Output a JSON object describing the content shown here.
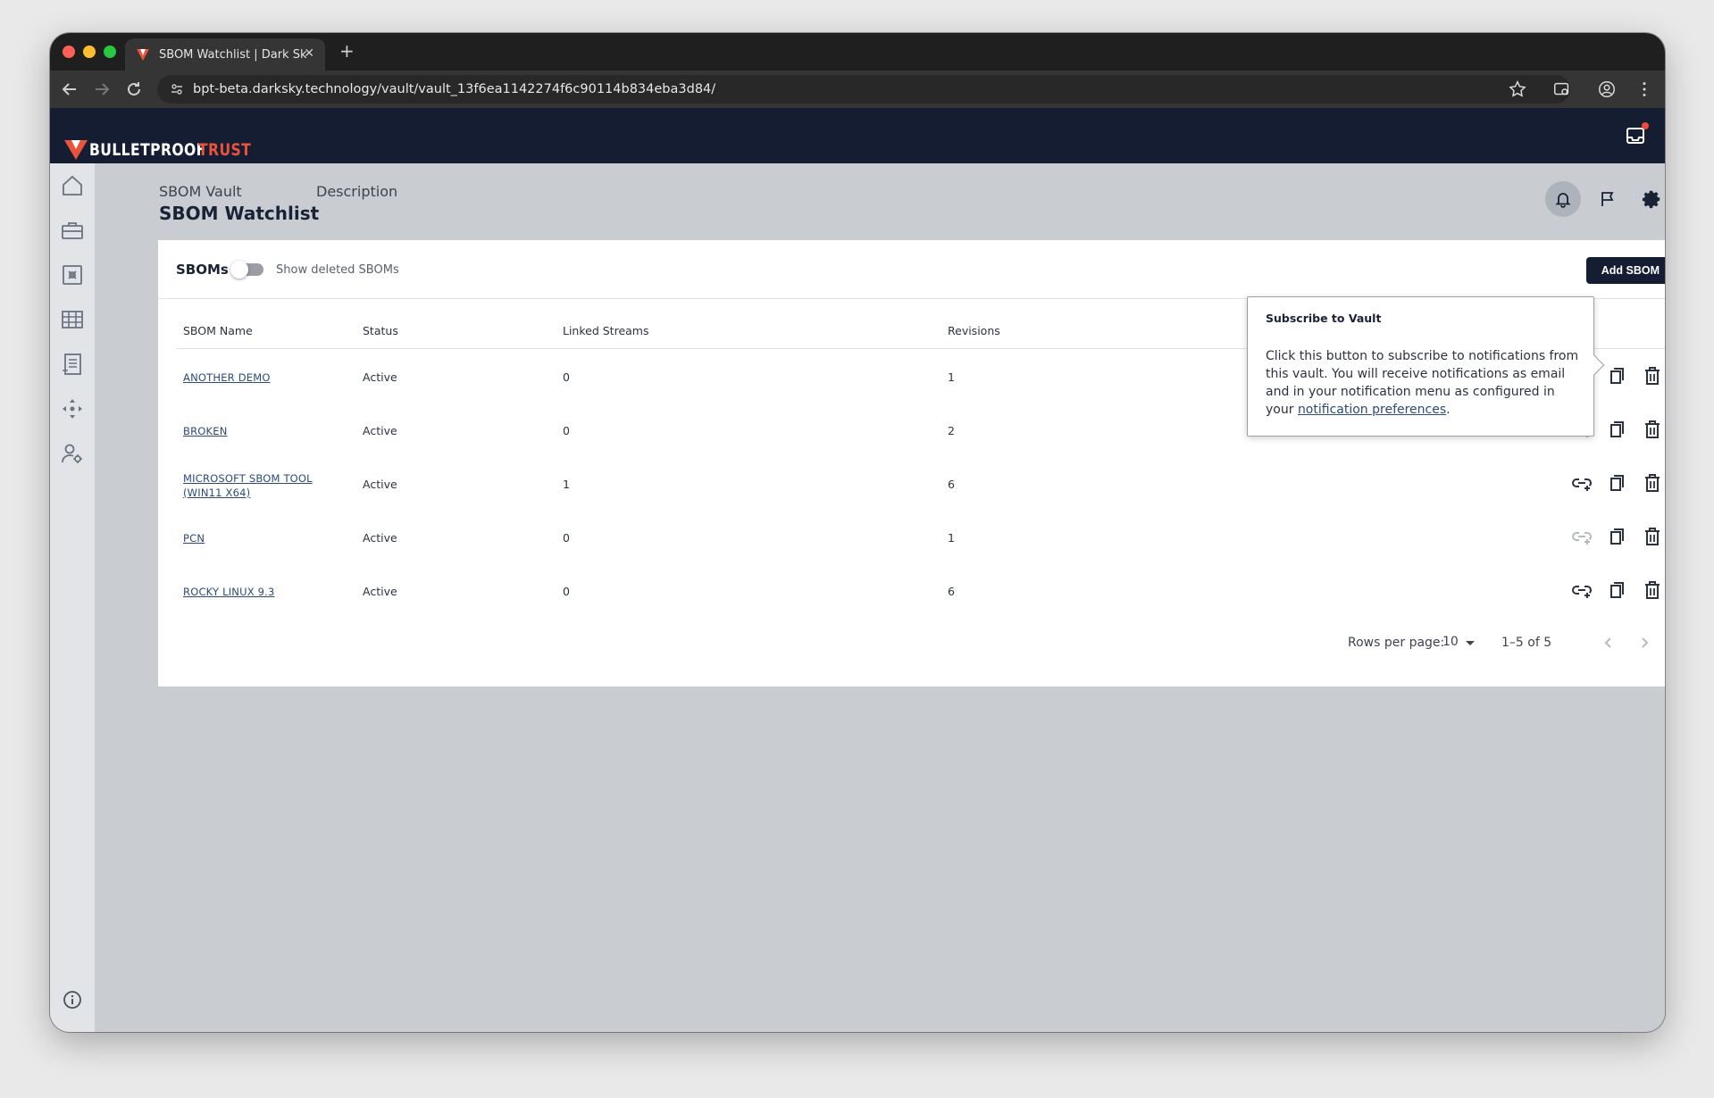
{
  "browser": {
    "tab_title": "SBOM Watchlist | Dark Sky Te",
    "tab_close": "✕",
    "new_tab": "+",
    "url": "bpt-beta.darksky.technology/vault/vault_13f6ea1142274f6c90114b834eba3d84/"
  },
  "app": {
    "logo_word_a": "BULLETPROOF",
    "logo_word_b": "TRUST",
    "brand_colors": {
      "navy": "#151d33",
      "accent": "#e8533a"
    }
  },
  "header": {
    "crumb": "SBOM Vault",
    "description_label": "Description",
    "title": "SBOM Watchlist"
  },
  "sboms": {
    "section_title": "SBOMs",
    "toggle_label": "Show deleted SBOMs",
    "add_button": "Add SBOM",
    "columns": [
      "SBOM Name",
      "Status",
      "Linked Streams",
      "Revisions"
    ],
    "rows": [
      {
        "name": "ANOTHER DEMO",
        "status": "Active",
        "linked_streams": "0",
        "revisions": "1",
        "link_enabled": true
      },
      {
        "name": "BROKEN",
        "status": "Active",
        "linked_streams": "0",
        "revisions": "2",
        "link_enabled": false
      },
      {
        "name": "MICROSOFT SBOM TOOL (WIN11 X64)",
        "status": "Active",
        "linked_streams": "1",
        "revisions": "6",
        "link_enabled": true
      },
      {
        "name": "PCN",
        "status": "Active",
        "linked_streams": "0",
        "revisions": "1",
        "link_enabled": false
      },
      {
        "name": "ROCKY LINUX 9.3",
        "status": "Active",
        "linked_streams": "0",
        "revisions": "6",
        "link_enabled": true
      }
    ],
    "pagination": {
      "rows_per_page_label": "Rows per page:",
      "rows_per_page": "10",
      "range": "1–5 of 5"
    }
  },
  "tooltip": {
    "title": "Subscribe to Vault",
    "body": "Click this button to subscribe to notifications from this vault. You will receive notifications as email and in your notification menu as configured in your",
    "link": "notification preferences",
    "end": "."
  }
}
